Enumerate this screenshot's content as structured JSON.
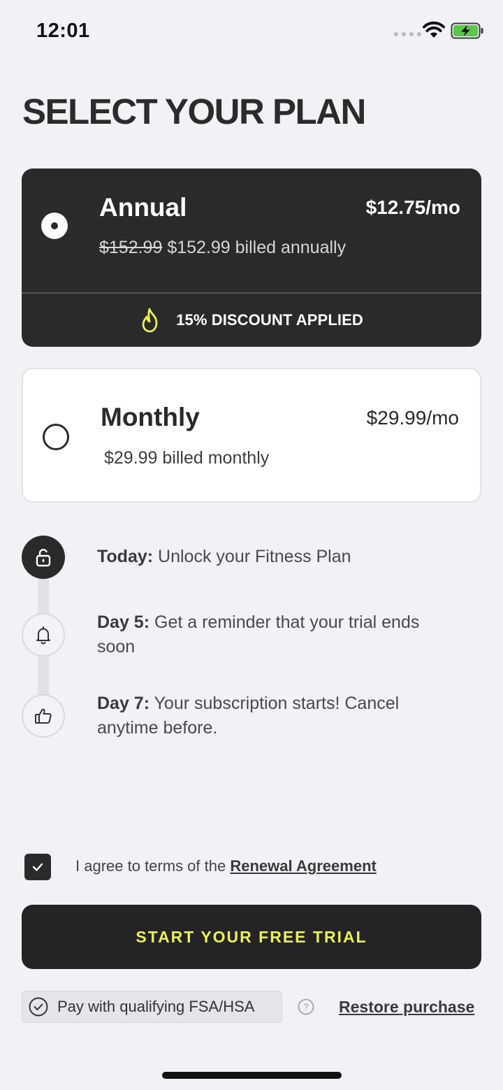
{
  "status_bar": {
    "time": "12:01"
  },
  "title": "SELECT YOUR PLAN",
  "plans": [
    {
      "name": "Annual",
      "price": "$12.75/mo",
      "original_price": "$152.99",
      "billing": "$152.99 billed annually",
      "badge": "15% DISCOUNT APPLIED",
      "selected": true
    },
    {
      "name": "Monthly",
      "price": "$29.99/mo",
      "billing": "$29.99 billed monthly",
      "selected": false
    }
  ],
  "timeline": [
    {
      "icon": "unlock-icon",
      "label": "Today:",
      "text": "Unlock your Fitness Plan"
    },
    {
      "icon": "bell-icon",
      "label": "Day 5:",
      "text": "Get a reminder that your trial ends soon"
    },
    {
      "icon": "thumbs-up-icon",
      "label": "Day 7:",
      "text": "Your subscription starts! Cancel anytime before."
    }
  ],
  "agreement": {
    "checked": true,
    "text": "I agree to terms of the",
    "link": "Renewal Agreement"
  },
  "cta": {
    "label": "START YOUR FREE TRIAL"
  },
  "fsa": {
    "label": "Pay with qualifying FSA/HSA"
  },
  "restore": {
    "label": "Restore purchase"
  },
  "colors": {
    "accent": "#eaf250",
    "dark": "#2b2a2b",
    "background": "#f1f1f6"
  }
}
